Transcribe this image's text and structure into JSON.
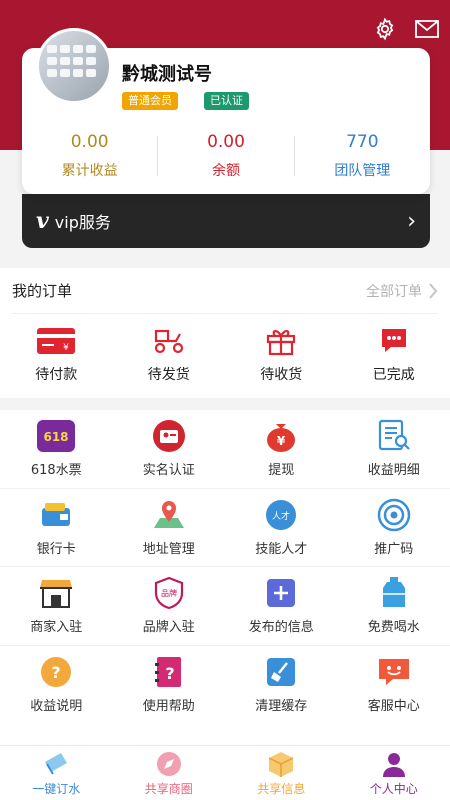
{
  "profile": {
    "username": "黔城测试号",
    "badge_member": "普通会员",
    "badge_verified": "已认证",
    "stats": [
      {
        "value": "0.00",
        "label": "累计收益"
      },
      {
        "value": "0.00",
        "label": "余额"
      },
      {
        "value": "770",
        "label": "团队管理"
      }
    ]
  },
  "vip": {
    "logo": "v",
    "label": "vip服务"
  },
  "orders": {
    "title": "我的订单",
    "all_label": "全部订单",
    "items": [
      {
        "label": "待付款"
      },
      {
        "label": "待发货"
      },
      {
        "label": "待收货"
      },
      {
        "label": "已完成"
      }
    ]
  },
  "services": [
    {
      "label": "618水票"
    },
    {
      "label": "实名认证"
    },
    {
      "label": "提现"
    },
    {
      "label": "收益明细"
    },
    {
      "label": "银行卡"
    },
    {
      "label": "地址管理"
    },
    {
      "label": "技能人才"
    },
    {
      "label": "推广码"
    },
    {
      "label": "商家入驻"
    },
    {
      "label": "品牌入驻"
    },
    {
      "label": "发布的信息"
    },
    {
      "label": "免费喝水"
    },
    {
      "label": "收益说明"
    },
    {
      "label": "使用帮助"
    },
    {
      "label": "清理缓存"
    },
    {
      "label": "客服中心"
    }
  ],
  "icon_texts": {
    "ticket": "618",
    "yen": "¥",
    "talent": "人才",
    "brand": "品牌",
    "question": "?"
  },
  "tabs": [
    {
      "label": "一键订水",
      "color": "#3a8fd9"
    },
    {
      "label": "共享商圈",
      "color": "#e9627a"
    },
    {
      "label": "共享信息",
      "color": "#f0a830"
    },
    {
      "label": "个人中心",
      "color": "#8a2a9a"
    }
  ],
  "colors": {
    "brand_red": "#a8172f",
    "icon_red": "#e02530"
  }
}
